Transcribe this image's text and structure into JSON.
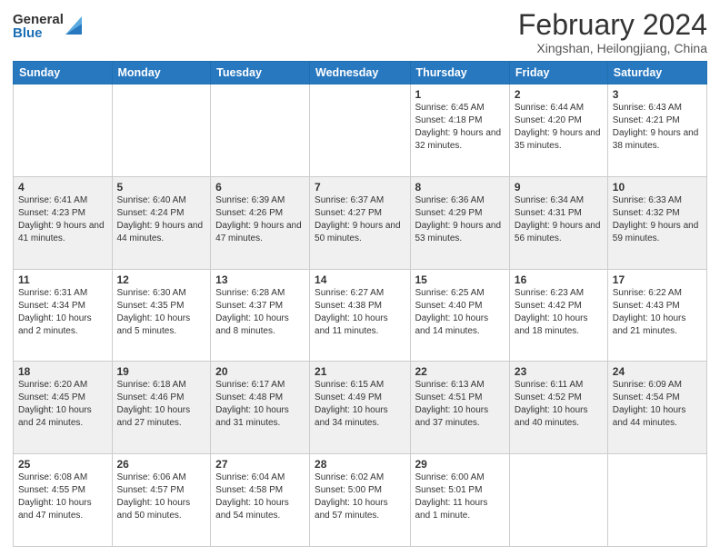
{
  "logo": {
    "general": "General",
    "blue": "Blue"
  },
  "title": "February 2024",
  "subtitle": "Xingshan, Heilongjiang, China",
  "days_of_week": [
    "Sunday",
    "Monday",
    "Tuesday",
    "Wednesday",
    "Thursday",
    "Friday",
    "Saturday"
  ],
  "weeks": [
    [
      {
        "day": "",
        "info": ""
      },
      {
        "day": "",
        "info": ""
      },
      {
        "day": "",
        "info": ""
      },
      {
        "day": "",
        "info": ""
      },
      {
        "day": "1",
        "info": "Sunrise: 6:45 AM\nSunset: 4:18 PM\nDaylight: 9 hours and 32 minutes."
      },
      {
        "day": "2",
        "info": "Sunrise: 6:44 AM\nSunset: 4:20 PM\nDaylight: 9 hours and 35 minutes."
      },
      {
        "day": "3",
        "info": "Sunrise: 6:43 AM\nSunset: 4:21 PM\nDaylight: 9 hours and 38 minutes."
      }
    ],
    [
      {
        "day": "4",
        "info": "Sunrise: 6:41 AM\nSunset: 4:23 PM\nDaylight: 9 hours and 41 minutes."
      },
      {
        "day": "5",
        "info": "Sunrise: 6:40 AM\nSunset: 4:24 PM\nDaylight: 9 hours and 44 minutes."
      },
      {
        "day": "6",
        "info": "Sunrise: 6:39 AM\nSunset: 4:26 PM\nDaylight: 9 hours and 47 minutes."
      },
      {
        "day": "7",
        "info": "Sunrise: 6:37 AM\nSunset: 4:27 PM\nDaylight: 9 hours and 50 minutes."
      },
      {
        "day": "8",
        "info": "Sunrise: 6:36 AM\nSunset: 4:29 PM\nDaylight: 9 hours and 53 minutes."
      },
      {
        "day": "9",
        "info": "Sunrise: 6:34 AM\nSunset: 4:31 PM\nDaylight: 9 hours and 56 minutes."
      },
      {
        "day": "10",
        "info": "Sunrise: 6:33 AM\nSunset: 4:32 PM\nDaylight: 9 hours and 59 minutes."
      }
    ],
    [
      {
        "day": "11",
        "info": "Sunrise: 6:31 AM\nSunset: 4:34 PM\nDaylight: 10 hours and 2 minutes."
      },
      {
        "day": "12",
        "info": "Sunrise: 6:30 AM\nSunset: 4:35 PM\nDaylight: 10 hours and 5 minutes."
      },
      {
        "day": "13",
        "info": "Sunrise: 6:28 AM\nSunset: 4:37 PM\nDaylight: 10 hours and 8 minutes."
      },
      {
        "day": "14",
        "info": "Sunrise: 6:27 AM\nSunset: 4:38 PM\nDaylight: 10 hours and 11 minutes."
      },
      {
        "day": "15",
        "info": "Sunrise: 6:25 AM\nSunset: 4:40 PM\nDaylight: 10 hours and 14 minutes."
      },
      {
        "day": "16",
        "info": "Sunrise: 6:23 AM\nSunset: 4:42 PM\nDaylight: 10 hours and 18 minutes."
      },
      {
        "day": "17",
        "info": "Sunrise: 6:22 AM\nSunset: 4:43 PM\nDaylight: 10 hours and 21 minutes."
      }
    ],
    [
      {
        "day": "18",
        "info": "Sunrise: 6:20 AM\nSunset: 4:45 PM\nDaylight: 10 hours and 24 minutes."
      },
      {
        "day": "19",
        "info": "Sunrise: 6:18 AM\nSunset: 4:46 PM\nDaylight: 10 hours and 27 minutes."
      },
      {
        "day": "20",
        "info": "Sunrise: 6:17 AM\nSunset: 4:48 PM\nDaylight: 10 hours and 31 minutes."
      },
      {
        "day": "21",
        "info": "Sunrise: 6:15 AM\nSunset: 4:49 PM\nDaylight: 10 hours and 34 minutes."
      },
      {
        "day": "22",
        "info": "Sunrise: 6:13 AM\nSunset: 4:51 PM\nDaylight: 10 hours and 37 minutes."
      },
      {
        "day": "23",
        "info": "Sunrise: 6:11 AM\nSunset: 4:52 PM\nDaylight: 10 hours and 40 minutes."
      },
      {
        "day": "24",
        "info": "Sunrise: 6:09 AM\nSunset: 4:54 PM\nDaylight: 10 hours and 44 minutes."
      }
    ],
    [
      {
        "day": "25",
        "info": "Sunrise: 6:08 AM\nSunset: 4:55 PM\nDaylight: 10 hours and 47 minutes."
      },
      {
        "day": "26",
        "info": "Sunrise: 6:06 AM\nSunset: 4:57 PM\nDaylight: 10 hours and 50 minutes."
      },
      {
        "day": "27",
        "info": "Sunrise: 6:04 AM\nSunset: 4:58 PM\nDaylight: 10 hours and 54 minutes."
      },
      {
        "day": "28",
        "info": "Sunrise: 6:02 AM\nSunset: 5:00 PM\nDaylight: 10 hours and 57 minutes."
      },
      {
        "day": "29",
        "info": "Sunrise: 6:00 AM\nSunset: 5:01 PM\nDaylight: 11 hours and 1 minute."
      },
      {
        "day": "",
        "info": ""
      },
      {
        "day": "",
        "info": ""
      }
    ]
  ]
}
